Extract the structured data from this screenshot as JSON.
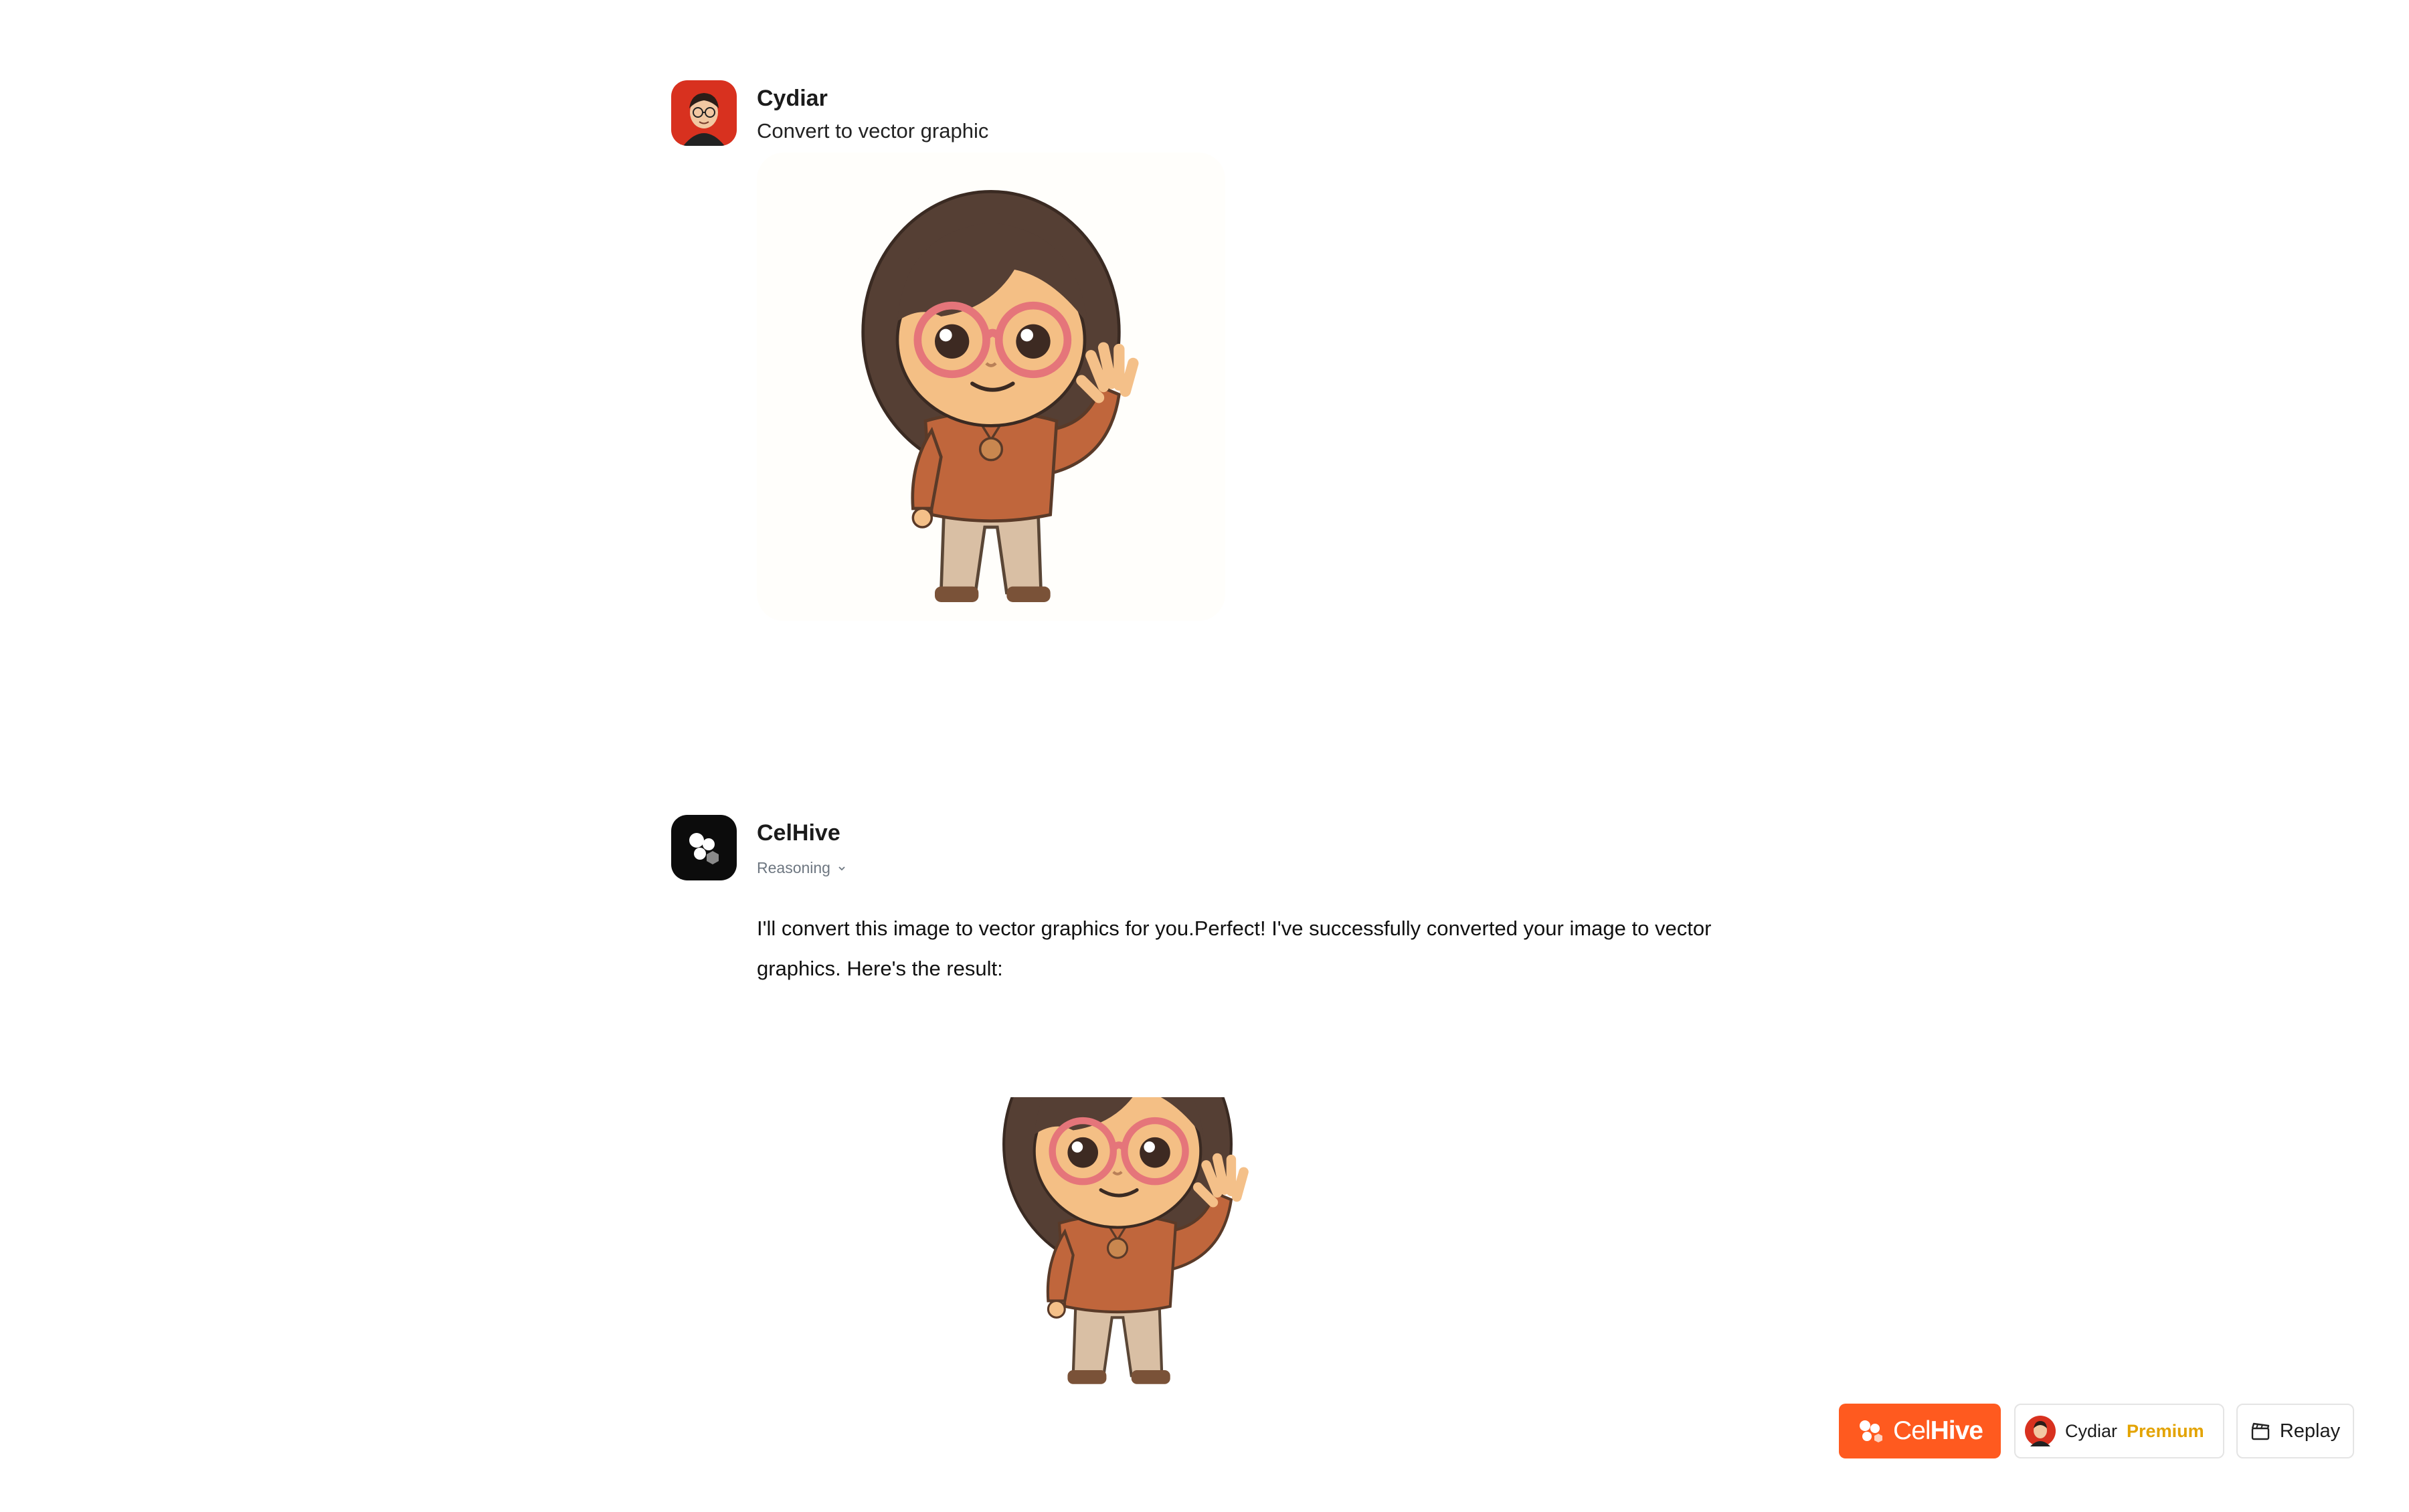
{
  "user_message": {
    "sender": "Cydiar",
    "text": "Convert to vector graphic",
    "avatar_icon": "user-avatar-icon",
    "attachment_icon": "girl-character-image"
  },
  "assistant_message": {
    "sender": "CelHive",
    "reasoning_label": "Reasoning",
    "avatar_icon": "celhive-logo-icon",
    "reply_text": "I'll convert this image to vector graphics for you.Perfect! I've successfully converted your image to vector graphics. Here's the result:",
    "result_icon": "vector-girl-character-image"
  },
  "footer": {
    "brand": {
      "cel": "Cel",
      "hive": "Hive",
      "color": "#ff5a1f"
    },
    "user": {
      "name": "Cydiar",
      "plan": "Premium",
      "plan_color": "#e3a300"
    },
    "replay_label": "Replay"
  }
}
